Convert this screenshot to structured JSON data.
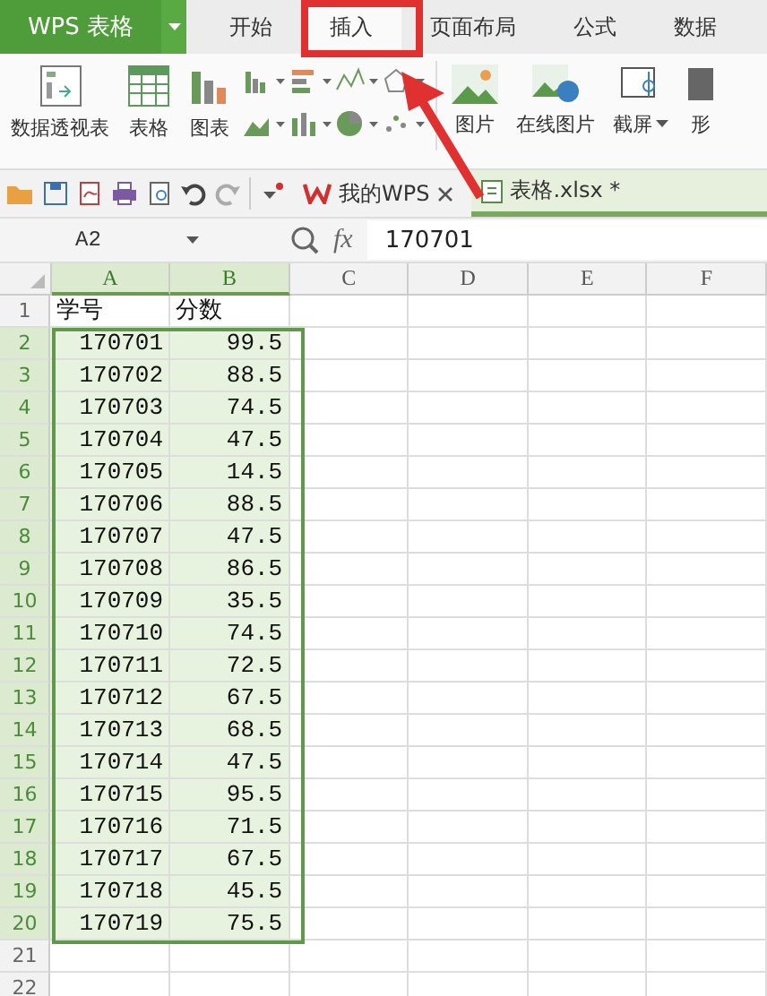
{
  "app_menu": {
    "label": "WPS 表格"
  },
  "ribbon_tabs": [
    {
      "label": "开始",
      "selected": false
    },
    {
      "label": "插入",
      "selected": true
    },
    {
      "label": "页面布局",
      "selected": false
    },
    {
      "label": "公式",
      "selected": false
    },
    {
      "label": "数据",
      "selected": false
    }
  ],
  "ribbon_left": [
    {
      "label": "数据透视表",
      "kind": "pivot"
    },
    {
      "label": "表格",
      "kind": "table"
    },
    {
      "label": "图表",
      "kind": "chart"
    }
  ],
  "ribbon_right": [
    {
      "label": "图片",
      "kind": "picture",
      "dropdown": false
    },
    {
      "label": "在线图片",
      "kind": "online",
      "dropdown": false
    },
    {
      "label": "截屏",
      "kind": "screenshot",
      "dropdown": true
    },
    {
      "label": "形",
      "kind": "shape",
      "dropdown": false
    }
  ],
  "doc_tabs": [
    {
      "label": "我的WPS",
      "kind": "home",
      "selected": false,
      "closable": true
    },
    {
      "label": "表格.xlsx *",
      "kind": "sheet",
      "selected": true,
      "closable": false
    }
  ],
  "formula_bar": {
    "cell_ref": "A2",
    "fx_label": "fx",
    "formula": "170701"
  },
  "columns": [
    {
      "label": "A",
      "selected": true
    },
    {
      "label": "B",
      "selected": true
    },
    {
      "label": "C",
      "selected": false
    },
    {
      "label": "D",
      "selected": false
    },
    {
      "label": "E",
      "selected": false
    },
    {
      "label": "F",
      "selected": false
    }
  ],
  "rows": [
    {
      "label": "1",
      "kind": "header",
      "selected": false,
      "cells": [
        "学号",
        "分数"
      ]
    },
    {
      "label": "2",
      "kind": "data",
      "selected": true,
      "cells": [
        "170701",
        "99.5"
      ]
    },
    {
      "label": "3",
      "kind": "data",
      "selected": true,
      "cells": [
        "170702",
        "88.5"
      ]
    },
    {
      "label": "4",
      "kind": "data",
      "selected": true,
      "cells": [
        "170703",
        "74.5"
      ]
    },
    {
      "label": "5",
      "kind": "data",
      "selected": true,
      "cells": [
        "170704",
        "47.5"
      ]
    },
    {
      "label": "6",
      "kind": "data",
      "selected": true,
      "cells": [
        "170705",
        "14.5"
      ]
    },
    {
      "label": "7",
      "kind": "data",
      "selected": true,
      "cells": [
        "170706",
        "88.5"
      ]
    },
    {
      "label": "8",
      "kind": "data",
      "selected": true,
      "cells": [
        "170707",
        "47.5"
      ]
    },
    {
      "label": "9",
      "kind": "data",
      "selected": true,
      "cells": [
        "170708",
        "86.5"
      ]
    },
    {
      "label": "10",
      "kind": "data",
      "selected": true,
      "cells": [
        "170709",
        "35.5"
      ]
    },
    {
      "label": "11",
      "kind": "data",
      "selected": true,
      "cells": [
        "170710",
        "74.5"
      ]
    },
    {
      "label": "12",
      "kind": "data",
      "selected": true,
      "cells": [
        "170711",
        "72.5"
      ]
    },
    {
      "label": "13",
      "kind": "data",
      "selected": true,
      "cells": [
        "170712",
        "67.5"
      ]
    },
    {
      "label": "14",
      "kind": "data",
      "selected": true,
      "cells": [
        "170713",
        "68.5"
      ]
    },
    {
      "label": "15",
      "kind": "data",
      "selected": true,
      "cells": [
        "170714",
        "47.5"
      ]
    },
    {
      "label": "16",
      "kind": "data",
      "selected": true,
      "cells": [
        "170715",
        "95.5"
      ]
    },
    {
      "label": "17",
      "kind": "data",
      "selected": true,
      "cells": [
        "170716",
        "71.5"
      ]
    },
    {
      "label": "18",
      "kind": "data",
      "selected": true,
      "cells": [
        "170717",
        "67.5"
      ]
    },
    {
      "label": "19",
      "kind": "data",
      "selected": true,
      "cells": [
        "170718",
        "45.5"
      ]
    },
    {
      "label": "20",
      "kind": "data",
      "selected": true,
      "cells": [
        "170719",
        "75.5"
      ]
    },
    {
      "label": "21",
      "kind": "data",
      "selected": false,
      "cells": []
    },
    {
      "label": "22",
      "kind": "data",
      "selected": false,
      "cells": []
    }
  ]
}
